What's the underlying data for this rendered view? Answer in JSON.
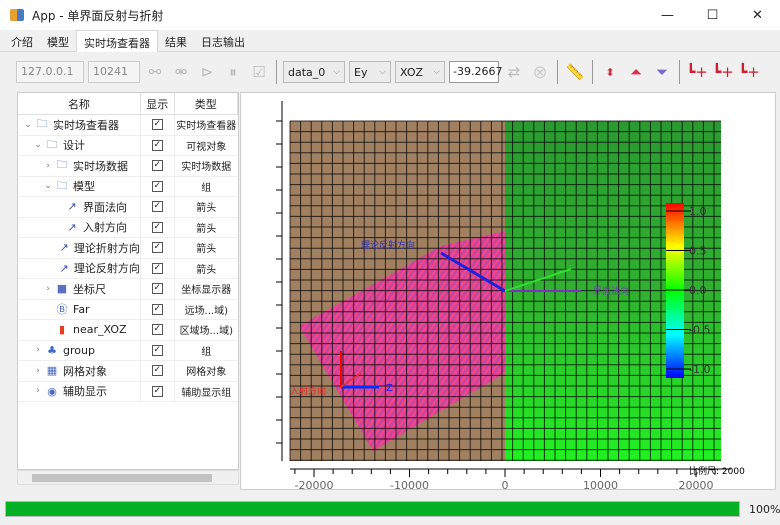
{
  "window": {
    "title": "App - 单界面反射与折射",
    "controls": [
      "minimize",
      "maximize",
      "close"
    ]
  },
  "tabs": [
    {
      "label": "介绍"
    },
    {
      "label": "模型"
    },
    {
      "label": "实时场查看器",
      "active": true
    },
    {
      "label": "结果"
    },
    {
      "label": "日志输出"
    }
  ],
  "toolbar": {
    "ip": "127.0.0.1",
    "port": "10241",
    "dataset": "data_0",
    "component": "Ey",
    "plane": "XOZ",
    "position": "-39.2667",
    "icons": [
      "link-icon",
      "unlink-icon",
      "play-icon",
      "pause-icon",
      "check-icon",
      "refresh-icon",
      "stop-icon",
      "ruler-icon",
      "expand-icon",
      "up-icon",
      "down-icon",
      "axis-x-icon",
      "axis-z-icon",
      "axis-y-icon"
    ]
  },
  "tree": {
    "headers": [
      "名称",
      "显示",
      "类型"
    ],
    "rows": [
      {
        "name": "实时场查看器",
        "type": "实时场查看器",
        "indent": 0,
        "chevron": "down",
        "icon": "folder"
      },
      {
        "name": "设计",
        "type": "可视对象",
        "indent": 1,
        "chevron": "down",
        "icon": "folder"
      },
      {
        "name": "实时场数据",
        "type": "实时场数据",
        "indent": 2,
        "chevron": "right",
        "icon": "folder"
      },
      {
        "name": "模型",
        "type": "组",
        "indent": 2,
        "chevron": "down",
        "icon": "folder"
      },
      {
        "name": "界面法向",
        "type": "箭头",
        "indent": 3,
        "chevron": "",
        "icon": "arrow"
      },
      {
        "name": "入射方向",
        "type": "箭头",
        "indent": 3,
        "chevron": "",
        "icon": "arrow"
      },
      {
        "name": "理论折射方向",
        "type": "箭头",
        "indent": 3,
        "chevron": "",
        "icon": "arrow"
      },
      {
        "name": "理论反射方向",
        "type": "箭头",
        "indent": 3,
        "chevron": "",
        "icon": "arrow"
      },
      {
        "name": "坐标尺",
        "type": "坐标显示器",
        "indent": 2,
        "chevron": "right",
        "icon": "cube"
      },
      {
        "name": "Far",
        "type": "远场...域)",
        "indent": 2,
        "chevron": "",
        "icon": "far"
      },
      {
        "name": "near_XOZ",
        "type": "区域场...域)",
        "indent": 2,
        "chevron": "",
        "icon": "colormap"
      },
      {
        "name": "group",
        "type": "组",
        "indent": 1,
        "chevron": "right",
        "icon": "group"
      },
      {
        "name": "网格对象",
        "type": "网格对象",
        "indent": 1,
        "chevron": "right",
        "icon": "grid"
      },
      {
        "name": "辅助显示",
        "type": "辅助显示组",
        "indent": 1,
        "chevron": "right",
        "icon": "eye"
      }
    ]
  },
  "viewer": {
    "x_ticks": [
      "-20000",
      "-10000",
      "0",
      "10000",
      "20000"
    ],
    "colorbar_ticks": [
      "1.0",
      "0.5",
      "0.0",
      "-0.5",
      "-1.0"
    ],
    "scale_label": "比例尺: 2000",
    "arrow_labels": {
      "reflect": "理论反射方向",
      "refract": "界面法向",
      "incident": "入射方向",
      "axis_z": "Z"
    }
  },
  "status": {
    "progress": 100,
    "progress_label": "100%"
  }
}
